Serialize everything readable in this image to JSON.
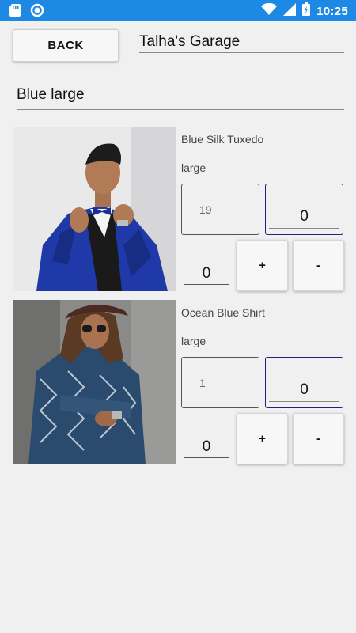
{
  "status_bar": {
    "time": "10:25",
    "icons": [
      "sd-card-icon",
      "circle-icon",
      "wifi-icon",
      "signal-icon",
      "battery-icon"
    ]
  },
  "header": {
    "back_label": "BACK",
    "store_name": "Talha's Garage"
  },
  "search": {
    "value": "Blue large"
  },
  "products": [
    {
      "name": "Blue Silk Tuxedo",
      "size": "large",
      "stock": "19",
      "quantity": "0",
      "count": "0",
      "plus_label": "+",
      "minus_label": "-"
    },
    {
      "name": "Ocean Blue Shirt",
      "size": "large",
      "stock": "1",
      "quantity": "0",
      "count": "0",
      "plus_label": "+",
      "minus_label": "-"
    }
  ],
  "colors": {
    "status_bar": "#1e88e5",
    "accent_border": "#1a237e",
    "background": "#f0f0f0"
  }
}
